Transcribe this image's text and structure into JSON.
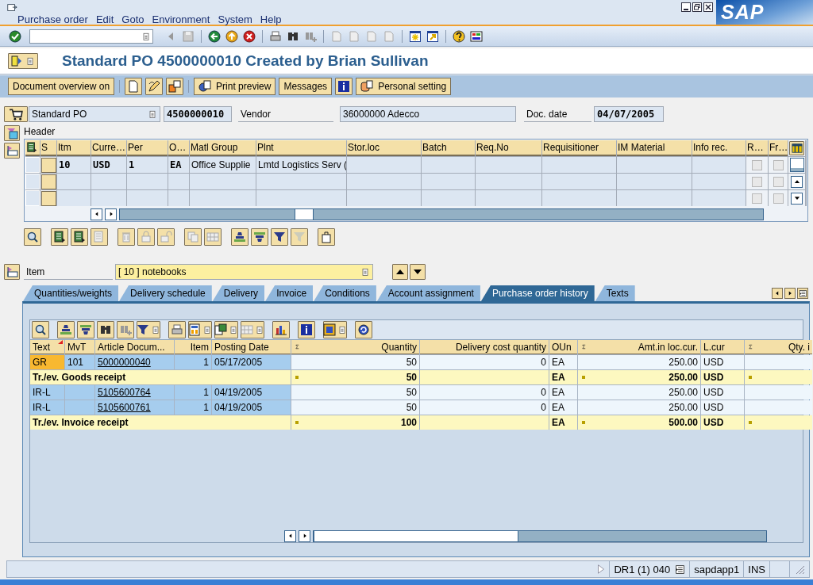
{
  "menu": [
    "Purchase order",
    "Edit",
    "Goto",
    "Environment",
    "System",
    "Help"
  ],
  "logo": "SAP",
  "title": "Standard PO 4500000010 Created by Brian Sullivan",
  "app_buttons": [
    "Document overview on",
    "Print preview",
    "Messages",
    "Personal setting"
  ],
  "header": {
    "doc_type": "Standard PO",
    "po_number": "4500000010",
    "vendor_label": "Vendor",
    "vendor": "36000000 Adecco",
    "doc_date_label": "Doc. date",
    "doc_date": "04/07/2005",
    "section_label": "Header"
  },
  "items_table": {
    "columns": [
      "S",
      "Itm",
      "Curre…",
      "Per",
      "O…",
      "Matl Group",
      "Plnt",
      "Stor.loc",
      "Batch",
      "Req.No",
      "Requisitioner",
      "IM Material",
      "Info rec.",
      "R…",
      "Fr…"
    ],
    "rows": [
      {
        "cells": [
          "10",
          "USD",
          "1",
          "EA",
          "Office Supplie",
          "Lmtd Logistics Serv ("
        ],
        "r_checked": false,
        "fr_checked": false
      },
      {
        "r_checked": false,
        "fr_checked": false
      },
      {
        "r_checked": false,
        "fr_checked": false
      }
    ]
  },
  "item_selector": {
    "label": "Item",
    "value": "[ 10 ] notebooks"
  },
  "tabs": [
    {
      "label": "Quantities/weights",
      "selected": false
    },
    {
      "label": "Delivery schedule",
      "selected": false
    },
    {
      "label": "Delivery",
      "selected": false
    },
    {
      "label": "Invoice",
      "selected": false
    },
    {
      "label": "Conditions",
      "selected": false
    },
    {
      "label": "Account assignment",
      "selected": false
    },
    {
      "label": "Purchase order history",
      "selected": true
    },
    {
      "label": "Texts",
      "selected": false
    }
  ],
  "history": {
    "columns": [
      {
        "label": "Text",
        "sorted": true
      },
      {
        "label": "MvT"
      },
      {
        "label": "Article Docum...",
        "link": true
      },
      {
        "label": "Item",
        "numeric": true
      },
      {
        "label": "Posting Date"
      },
      {
        "label": "Quantity",
        "numeric": true,
        "sigma": true
      },
      {
        "label": "Delivery cost quantity",
        "numeric": true
      },
      {
        "label": "OUn"
      },
      {
        "label": "Amt.in loc.cur.",
        "numeric": true,
        "sigma": true
      },
      {
        "label": "L.cur"
      },
      {
        "label": "Qty. i",
        "numeric": true,
        "sigma": true
      }
    ],
    "rows": [
      {
        "kind": "line",
        "highlighted": true,
        "cells": [
          "GR",
          "101",
          "5000000040",
          "1",
          "05/17/2005",
          "50",
          "0",
          "EA",
          "250.00",
          "USD"
        ]
      },
      {
        "kind": "total",
        "label": "Tr./ev. Goods receipt",
        "quantity": "50",
        "unit": "EA",
        "amount": "250.00",
        "currency": "USD"
      },
      {
        "kind": "line",
        "highlighted": false,
        "cells": [
          "IR-L",
          null,
          "5105600764",
          "1",
          "04/19/2005",
          "50",
          "0",
          "EA",
          "250.00",
          "USD"
        ]
      },
      {
        "kind": "line",
        "highlighted": false,
        "cells": [
          "IR-L",
          null,
          "5105600761",
          "1",
          "04/19/2005",
          "50",
          "0",
          "EA",
          "250.00",
          "USD"
        ]
      },
      {
        "kind": "total",
        "label": "Tr./ev. Invoice receipt",
        "quantity": "100",
        "unit": "EA",
        "amount": "500.00",
        "currency": "USD"
      }
    ]
  },
  "status": {
    "system": "DR1 (1) 040",
    "server": "sapdapp1",
    "mode": "INS"
  }
}
